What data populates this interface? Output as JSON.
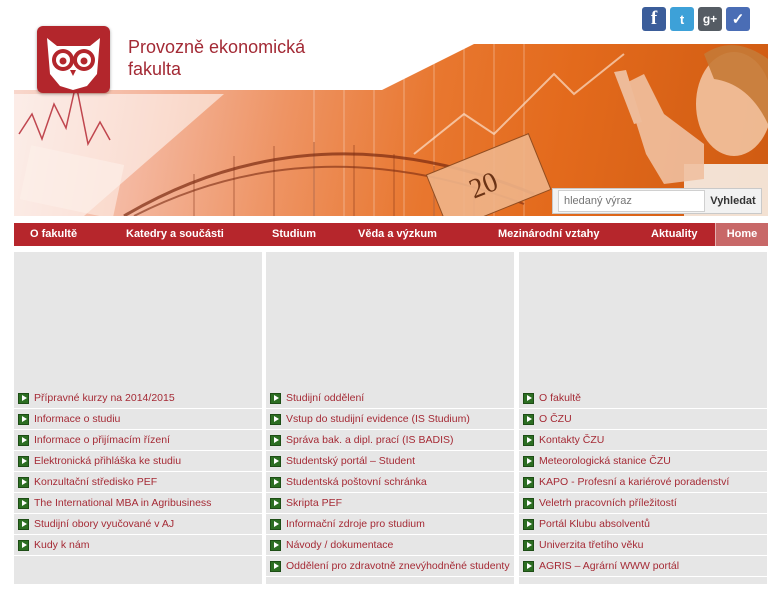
{
  "header": {
    "faculty_name_line1": "Provozně ekonomická",
    "faculty_name_line2": "fakulta",
    "logo_icon": "owl-icon",
    "social": [
      {
        "name": "facebook-icon",
        "glyph": "f"
      },
      {
        "name": "twitter-icon",
        "glyph": "t"
      },
      {
        "name": "google-plus-icon",
        "glyph": "g+"
      },
      {
        "name": "checkmark-icon",
        "glyph": "✓"
      }
    ],
    "banner_note": "20",
    "search": {
      "placeholder": "hledaný výraz",
      "button_label": "Vyhledat"
    }
  },
  "nav": {
    "items": [
      "O fakultě",
      "Katedry a součásti",
      "Studium",
      "Věda a výzkum",
      "Mezinárodní vztahy",
      "Aktuality"
    ],
    "home": "Home"
  },
  "columns": [
    {
      "links": [
        "Přípravné kurzy na 2014/2015",
        "Informace o studiu",
        "Informace o přijímacím řízení",
        "Elektronická přihláška ke studiu",
        "Konzultační středisko PEF",
        "The International MBA in Agribusiness",
        "Studijní obory vyučované v AJ",
        "Kudy k nám"
      ]
    },
    {
      "links": [
        "Studijní oddělení",
        "Vstup do studijní evidence (IS Studium)",
        "Správa bak. a dipl. prací (IS BADIS)",
        "Studentský portál – Student",
        "Studentská poštovní schránka",
        "Skripta PEF",
        "Informační zdroje pro studium",
        "Návody / dokumentace",
        "Oddělení pro zdravotně znevýhodněné studenty"
      ]
    },
    {
      "links": [
        "O fakultě",
        "O ČZU",
        "Kontakty ČZU",
        "Meteorologická stanice ČZU",
        "KAPO - Profesní a kariérové poradenství",
        "Veletrh pracovních příležitostí",
        "Portál Klubu absolventů",
        "Univerzita třetího věku",
        "AGRIS – Agrární WWW portál"
      ]
    }
  ],
  "colors": {
    "brand": "#b6262c",
    "link": "#a52a35",
    "bullet": "#2c6e22",
    "panel": "#e6e6e6"
  }
}
